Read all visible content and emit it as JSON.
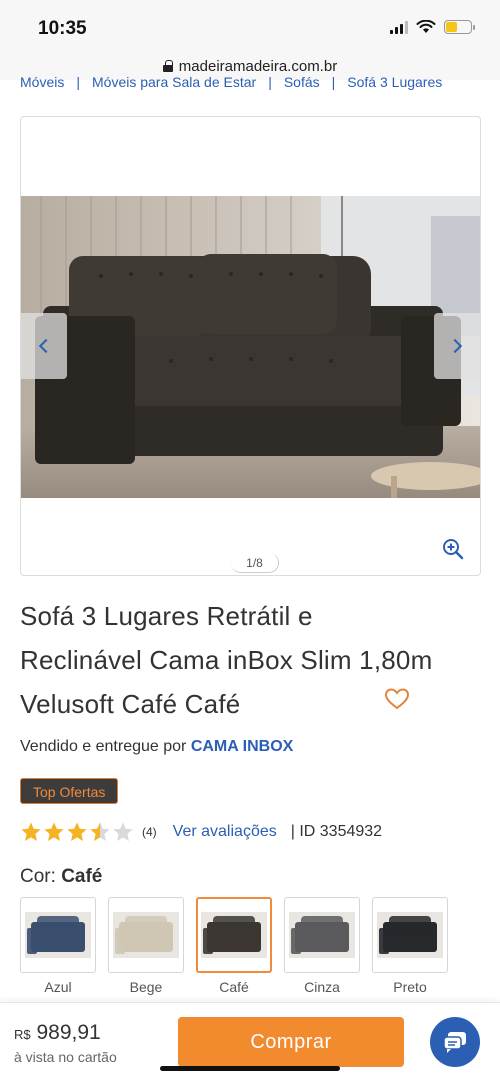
{
  "status": {
    "time": "10:35",
    "battery_level": 0.45
  },
  "browser": {
    "url": "madeiramadeira.com.br"
  },
  "breadcrumb": [
    "Móveis",
    "Móveis para Sala de Estar",
    "Sofás",
    "Sofá 3 Lugares"
  ],
  "gallery": {
    "counter": "1/8",
    "current": 1,
    "total": 8
  },
  "product": {
    "title": "Sofá 3 Lugares Retrátil e Reclinável Cama inBox Slim 1,80m Velusoft Café Café",
    "seller_prefix": "Vendido e entregue por",
    "seller_name": "CAMA INBOX",
    "badge": "Top Ofertas",
    "rating": 3.5,
    "rating_max": 5,
    "rating_count": "(4)",
    "reviews_link": "Ver avaliações",
    "product_id": "| ID 3354932",
    "color_label": "Cor:",
    "color_selected": "Café"
  },
  "colors": [
    {
      "name": "Azul",
      "hex": "#3a4e6e",
      "selected": false
    },
    {
      "name": "Bege",
      "hex": "#cfc7b4",
      "selected": false
    },
    {
      "name": "Café",
      "hex": "#3b3632",
      "selected": true
    },
    {
      "name": "Cinza",
      "hex": "#5a5a5c",
      "selected": false
    },
    {
      "name": "Preto",
      "hex": "#26282c",
      "selected": false
    }
  ],
  "footer": {
    "currency": "R$",
    "price": "989,91",
    "price_note": "à vista no cartão",
    "buy_label": "Comprar"
  },
  "theme": {
    "link": "#2b5fb3",
    "accent": "#f28a2e",
    "star": "#f5b324"
  }
}
